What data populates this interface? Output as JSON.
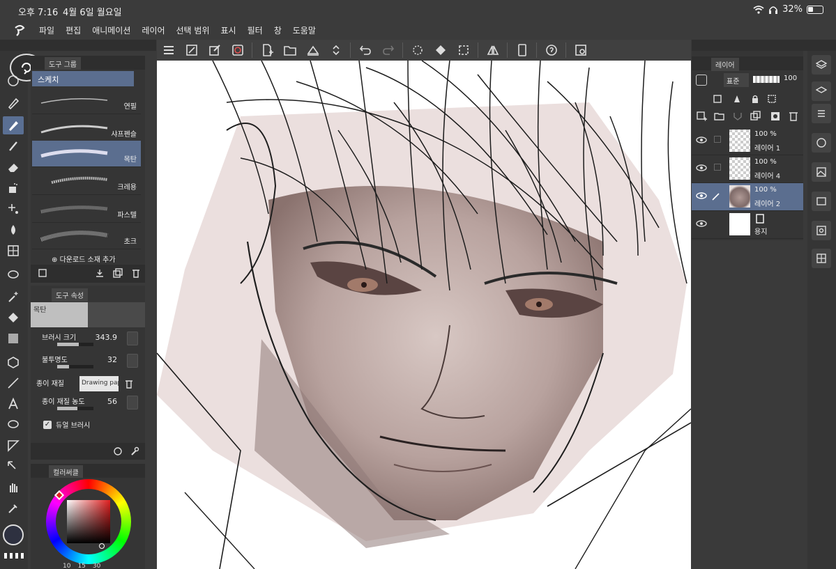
{
  "status": {
    "time": "오후 7:16",
    "date": "4월 6일 월요일",
    "battery": "32%"
  },
  "menu": [
    "파일",
    "편집",
    "애니메이션",
    "레이어",
    "선택 범위",
    "표시",
    "필터",
    "창",
    "도움말"
  ],
  "subtool": {
    "tab": "도구 그룹",
    "group": "스케치",
    "brushes": [
      {
        "name": "연필",
        "active": false
      },
      {
        "name": "샤프펜슬",
        "active": false
      },
      {
        "name": "목탄",
        "active": true
      },
      {
        "name": "크레용",
        "active": false
      },
      {
        "name": "파스텔",
        "active": false
      },
      {
        "name": "초크",
        "active": false
      }
    ],
    "download": "다운로드 소재 추가"
  },
  "toolprop": {
    "tab": "도구 속성",
    "preview": "목탄",
    "brush_size_label": "브러시 크기",
    "brush_size": "343.9",
    "brush_size_fraction": 0.6,
    "opacity_label": "불투명도",
    "opacity": "32",
    "opacity_fraction": 0.32,
    "paper_label": "종이 재질",
    "paper_value": "Drawing paper",
    "paper_density_label": "종이 재질 농도",
    "paper_density": "56",
    "paper_density_fraction": 0.56,
    "dual_brush_label": "듀얼 브러시",
    "dual_brush_checked": true
  },
  "color": {
    "tab": "컬러써클",
    "main": "#2e3140",
    "accent": "#e02020",
    "sizes": [
      "10",
      "15",
      "30"
    ]
  },
  "layers": {
    "tab": "레이어",
    "blend_mode": "표준",
    "opacity": "100",
    "rows": [
      {
        "pct": "100 %",
        "name": "레이어 1",
        "active": false,
        "thumb": "transparent"
      },
      {
        "pct": "100 %",
        "name": "레이어 4",
        "active": false,
        "thumb": "transparent"
      },
      {
        "pct": "100 %",
        "name": "레이어 2",
        "active": true,
        "thumb": "art"
      },
      {
        "pct": "",
        "name": "용지",
        "active": false,
        "thumb": "white"
      }
    ]
  },
  "accent_blue": "#5b6e8f"
}
